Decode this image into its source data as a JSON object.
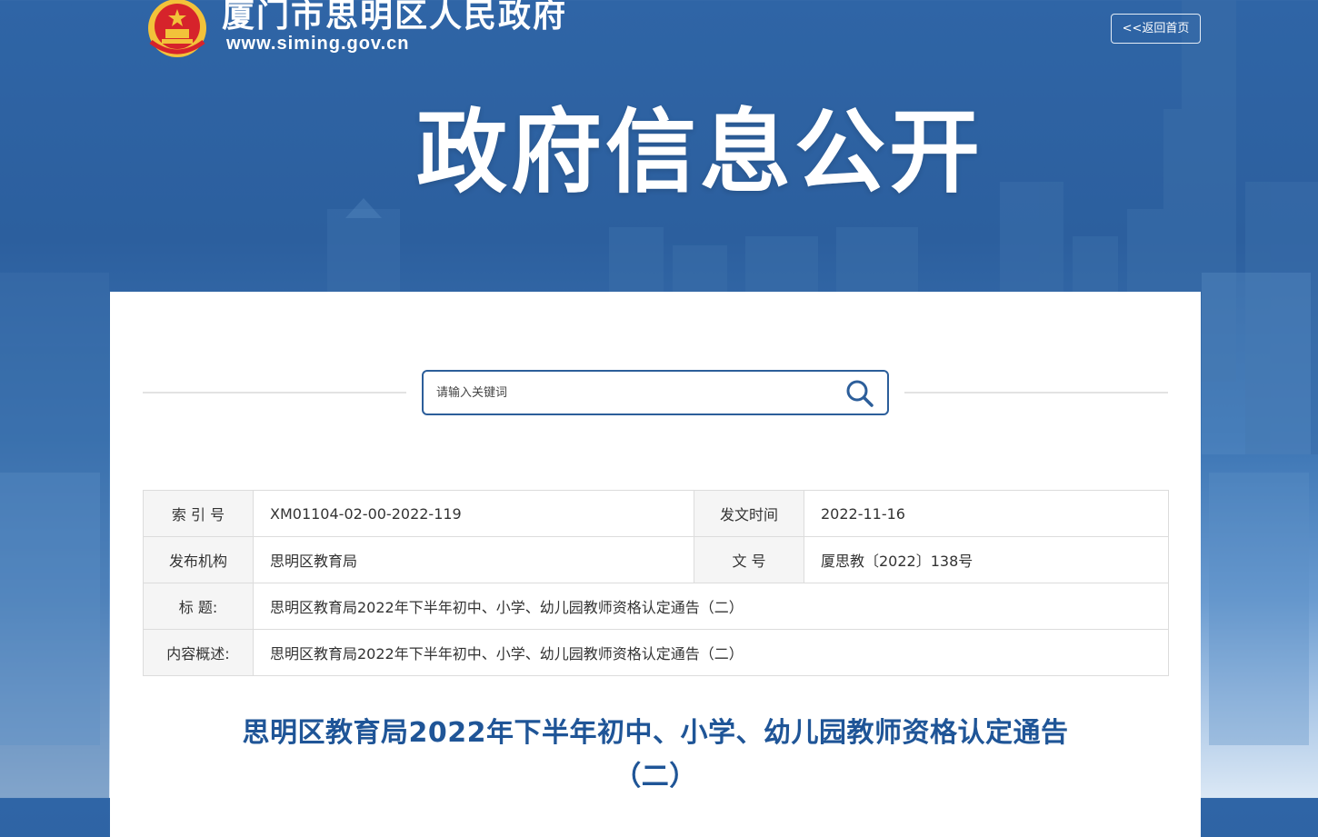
{
  "header": {
    "site_name": "厦门市思明区人民政府",
    "site_url": "www.siming.gov.cn",
    "back_home_label": "<<返回首页"
  },
  "banner": {
    "title": "政府信息公开"
  },
  "search": {
    "placeholder": "请输入关键词",
    "icon": "search-icon"
  },
  "meta": {
    "index_no_label": "索 引 号",
    "index_no_value": "XM01104-02-00-2022-119",
    "issue_date_label": "发文时间",
    "issue_date_value": "2022-11-16",
    "publisher_label": "发布机构",
    "publisher_value": "思明区教育局",
    "doc_no_label": "文 号",
    "doc_no_value": "厦思教〔2022〕138号",
    "title_label": "标 题:",
    "title_value": "思明区教育局2022年下半年初中、小学、幼儿园教师资格认定通告（二）",
    "summary_label": "内容概述:",
    "summary_value": "思明区教育局2022年下半年初中、小学、幼儿园教师资格认定通告（二）"
  },
  "document": {
    "title_line1": "思明区教育局2022年下半年初中、小学、幼儿园教师资格认定通告",
    "title_line2": "（二）"
  },
  "colors": {
    "brand_blue": "#2c5e9a",
    "title_blue": "#1f5597",
    "emblem_red": "#d6232b",
    "emblem_gold": "#f2c23a"
  }
}
